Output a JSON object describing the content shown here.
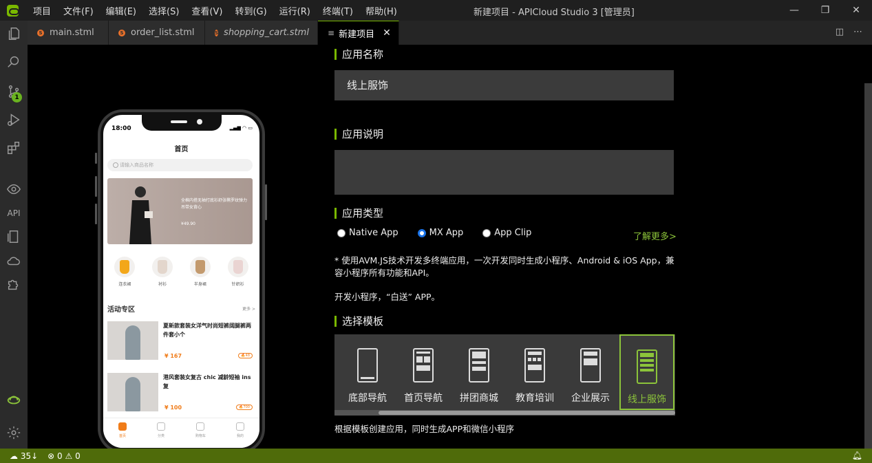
{
  "menu": [
    "项目",
    "文件(F)",
    "编辑(E)",
    "选择(S)",
    "查看(V)",
    "转到(G)",
    "运行(R)",
    "终端(T)",
    "帮助(H)"
  ],
  "window_title": "新建项目 - APICloud Studio 3 [管理员]",
  "window_controls": {
    "minimize": "—",
    "restore": "❐",
    "close": "✕"
  },
  "activity": {
    "badge": "1",
    "api_label": "API"
  },
  "tabs": [
    {
      "label": "main.stml",
      "icon": "stml-file-icon"
    },
    {
      "label": "order_list.stml",
      "icon": "stml-file-icon"
    },
    {
      "label": "shopping_cart.stml",
      "icon": "stml-file-icon"
    },
    {
      "label": "新建项目",
      "icon": "preview-icon"
    }
  ],
  "tab_close": "✕",
  "phone": {
    "time": "18:00",
    "title": "首页",
    "search_placeholder": "请输入商品名称",
    "banner_text": "全棉内搭无袖打底衫舒张椭罗纹弹力吊带女背心",
    "banner_price": "¥49.90",
    "categories": [
      "连衣裙",
      "衬衫",
      "半身裙",
      "针织衫"
    ],
    "section_title": "活动专区",
    "section_more": "更多 >",
    "products": [
      {
        "title": "夏新款套装女洋气时尚短裤阔腿裤两件套小个",
        "price": "¥ 167",
        "tag": "🔥48"
      },
      {
        "title": "港风套装女复古 chic 减龄短袖 ins复",
        "price": "¥ 100",
        "tag": "🔥700"
      }
    ],
    "tabbar": [
      "首页",
      "分类",
      "购物车",
      "我的"
    ]
  },
  "form": {
    "app_name_label": "应用名称",
    "app_name_value": "线上服饰",
    "app_desc_label": "应用说明",
    "app_desc_value": "",
    "app_type_label": "应用类型",
    "app_types": [
      {
        "label": "Native App",
        "selected": false
      },
      {
        "label": "MX App",
        "selected": true
      },
      {
        "label": "App Clip",
        "selected": false
      }
    ],
    "learn_more": "了解更多>",
    "type_note": "* 使用AVM.JS技术开发多终端应用，一次开发同时生成小程序、Android & iOS App，兼容小程序所有功能和API。",
    "type_note2": "开发小程序，“白送” APP。",
    "template_label": "选择模板",
    "templates": [
      "底部导航",
      "首页导航",
      "拼团商城",
      "教育培训",
      "企业展示",
      "线上服饰"
    ],
    "selected_template": "线上服饰",
    "template_note": "根据模板创建应用，同时生成APP和微信小程序"
  },
  "statusbar": {
    "sync": "35↓",
    "errors": "0",
    "warnings": "0"
  },
  "colors": {
    "accent": "#7ab800",
    "statusbar": "#4f6b0a",
    "link": "#8cc43a",
    "phone_accent": "#f07c19"
  }
}
